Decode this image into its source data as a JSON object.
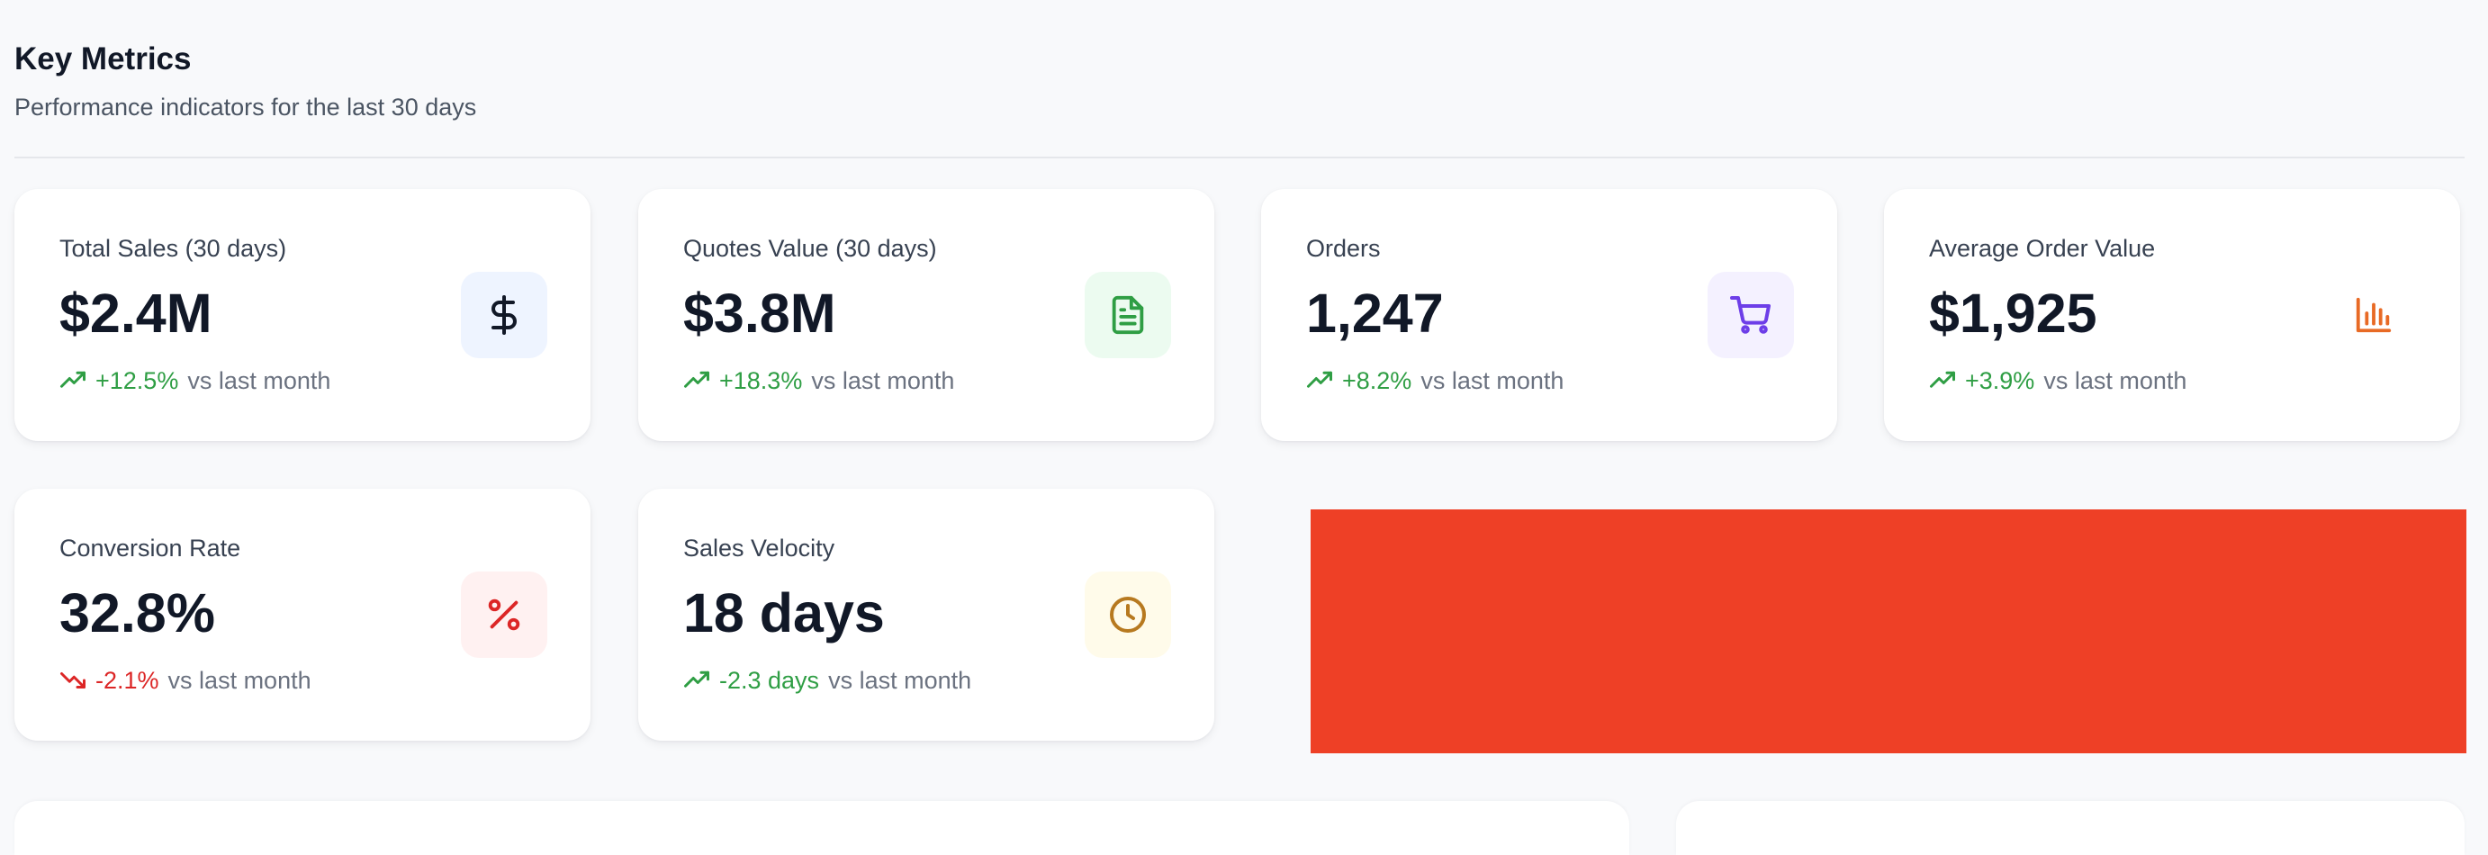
{
  "section": {
    "title": "Key Metrics",
    "subtitle": "Performance indicators for the last 30 days"
  },
  "metrics": [
    {
      "label": "Total Sales (30 days)",
      "value": "$2.4M",
      "trend": "+12.5%",
      "trend_direction": "up",
      "trend_suffix": "vs last month",
      "icon": "dollar-icon",
      "icon_color": "#111827",
      "icon_bg": "#eef4ff"
    },
    {
      "label": "Quotes Value (30 days)",
      "value": "$3.8M",
      "trend": "+18.3%",
      "trend_direction": "up",
      "trend_suffix": "vs last month",
      "icon": "document-icon",
      "icon_color": "#2f9e44",
      "icon_bg": "#ecfbf0"
    },
    {
      "label": "Orders",
      "value": "1,247",
      "trend": "+8.2%",
      "trend_direction": "up",
      "trend_suffix": "vs last month",
      "icon": "shopping-cart-icon",
      "icon_color": "#6d3ee8",
      "icon_bg": "#f4f1ff"
    },
    {
      "label": "Average Order Value",
      "value": "$1,925",
      "trend": "+3.9%",
      "trend_direction": "up",
      "trend_suffix": "vs last month",
      "icon": "bar-chart-icon",
      "icon_color": "#e86a25",
      "icon_bg": "#ffffff"
    },
    {
      "label": "Conversion Rate",
      "value": "32.8%",
      "trend": "-2.1%",
      "trend_direction": "down",
      "trend_suffix": "vs last month",
      "icon": "percent-icon",
      "icon_color": "#dc2626",
      "icon_bg": "#fff1f1"
    },
    {
      "label": "Sales Velocity",
      "value": "18 days",
      "trend": "-2.3 days",
      "trend_direction": "up",
      "trend_suffix": "vs last month",
      "icon": "clock-icon",
      "icon_color": "#b7791f",
      "icon_bg": "#fffbea"
    }
  ],
  "colors": {
    "trend_up": "#2f9e44",
    "trend_down": "#dc2626",
    "placeholder_block": "#ee4026",
    "page_background": "#f8f9fb"
  }
}
